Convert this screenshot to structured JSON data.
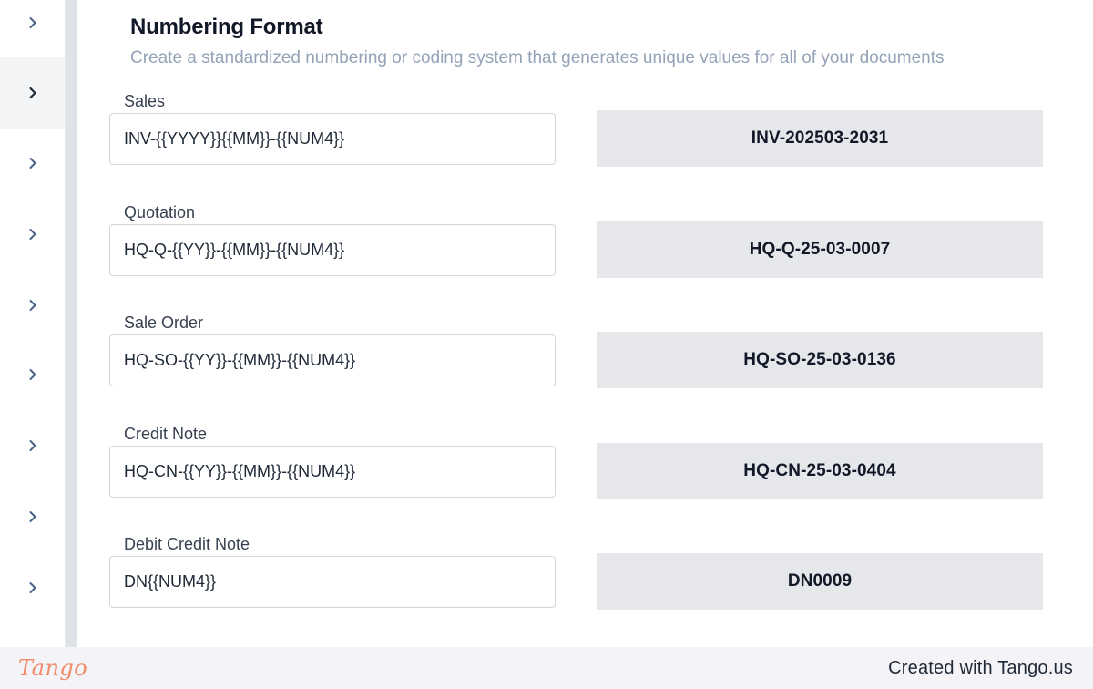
{
  "sidebar": {
    "items": [
      {
        "icon": "chevron-right-icon",
        "active": false
      },
      {
        "icon": "chevron-right-icon",
        "active": true
      },
      {
        "icon": "chevron-right-icon",
        "active": false
      },
      {
        "icon": "chevron-right-icon",
        "active": false
      },
      {
        "icon": "chevron-right-icon",
        "active": false
      },
      {
        "icon": "chevron-right-icon",
        "active": false
      },
      {
        "icon": "chevron-right-icon",
        "active": false
      },
      {
        "icon": "chevron-right-icon",
        "active": false
      },
      {
        "icon": "chevron-right-icon",
        "active": false
      }
    ]
  },
  "section": {
    "title": "Numbering Format",
    "subtitle": "Create a standardized numbering or coding system that generates unique values for all of your documents"
  },
  "formats": [
    {
      "label": "Sales",
      "value": "INV-{{YYYY}}{{MM}}-{{NUM4}}",
      "preview": "INV-202503-2031"
    },
    {
      "label": "Quotation",
      "value": "HQ-Q-{{YY}}-{{MM}}-{{NUM4}}",
      "preview": "HQ-Q-25-03-0007"
    },
    {
      "label": "Sale Order",
      "value": "HQ-SO-{{YY}}-{{MM}}-{{NUM4}}",
      "preview": "HQ-SO-25-03-0136"
    },
    {
      "label": "Credit Note",
      "value": "HQ-CN-{{YY}}-{{MM}}-{{NUM4}}",
      "preview": "HQ-CN-25-03-0404"
    },
    {
      "label": "Debit Credit Note",
      "value": "DN{{NUM4}}",
      "preview": "DN0009"
    }
  ],
  "footer": {
    "logo": "Tango",
    "credit": "Created with Tango.us"
  },
  "colors": {
    "preview_bg": "#e5e7eb",
    "subtitle": "#94a3b8",
    "chevron": "#4b6287",
    "logo": "#f08c6c"
  }
}
